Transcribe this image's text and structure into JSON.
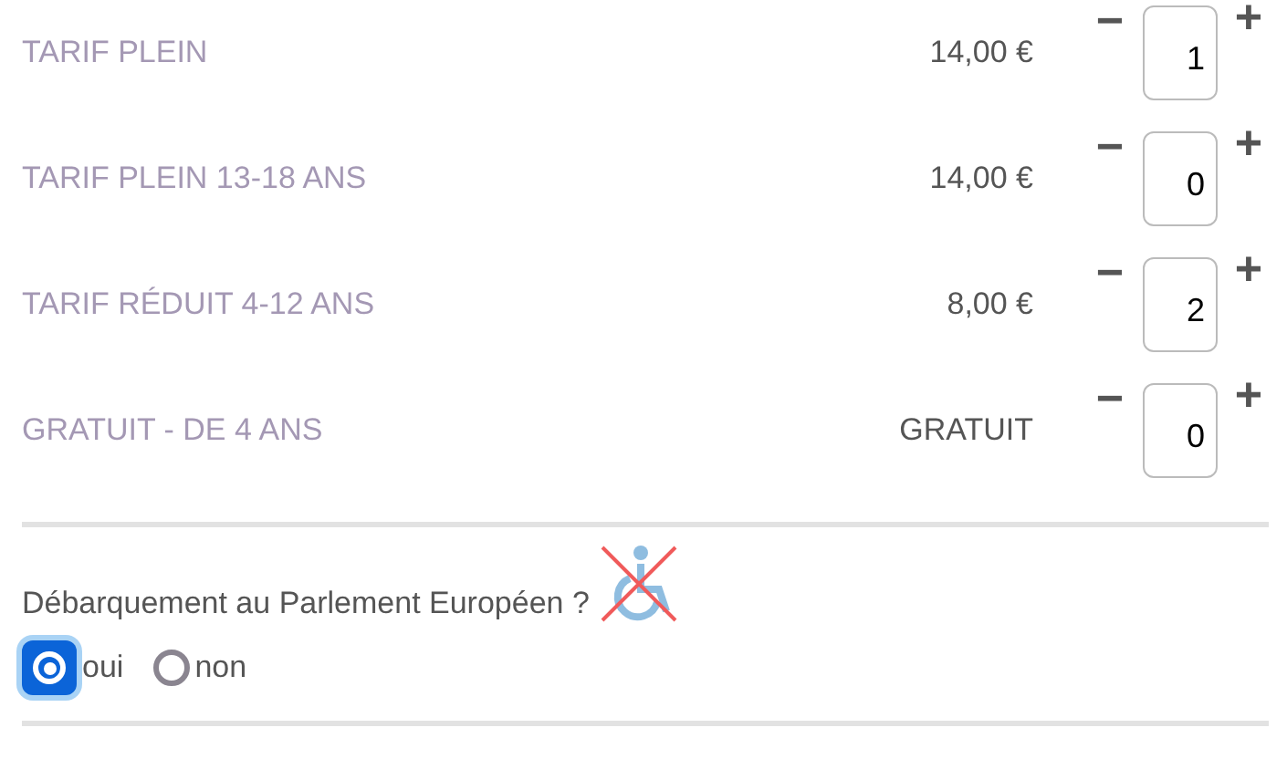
{
  "tariffs": [
    {
      "label": "TARIF PLEIN",
      "price": "14,00 €",
      "quantity": "1"
    },
    {
      "label": "TARIF PLEIN 13-18 ANS",
      "price": "14,00 €",
      "quantity": "0"
    },
    {
      "label": "TARIF RÉDUIT 4-12 ANS",
      "price": "8,00 €",
      "quantity": "2"
    },
    {
      "label": "GRATUIT - DE 4 ANS",
      "price": "GRATUIT",
      "quantity": "0"
    }
  ],
  "decrement_symbol": "−",
  "increment_symbol": "+",
  "question": {
    "text": "Débarquement au Parlement Européen ?",
    "wheelchair_accessible": false
  },
  "options": [
    {
      "label": "oui",
      "selected": true
    },
    {
      "label": "non",
      "selected": false
    }
  ]
}
